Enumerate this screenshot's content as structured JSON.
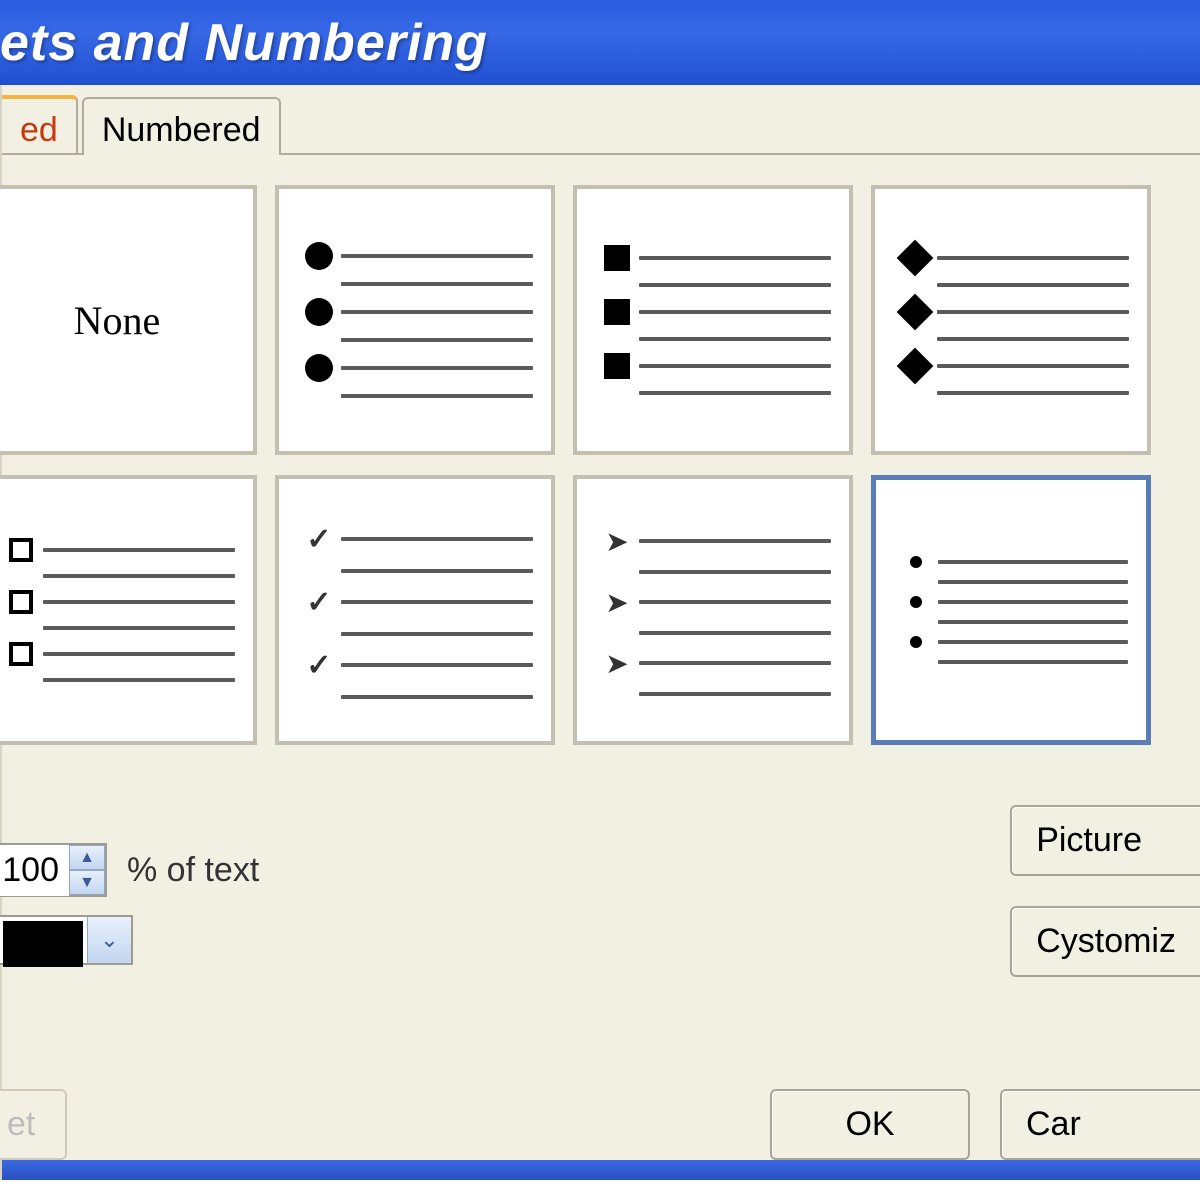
{
  "title": "ets and Numbering",
  "tabs": {
    "bulleted_partial": "ed",
    "numbered": "Numbered"
  },
  "tiles": {
    "none_label": "None",
    "selected_index": 7
  },
  "size": {
    "value": "100",
    "label": "% of text"
  },
  "buttons": {
    "picture": "Picture",
    "customize": "Cystomiz",
    "reset": "et",
    "ok": "OK",
    "cancel": "Car"
  },
  "icons": {
    "spin_up": "▲",
    "spin_down": "▼",
    "dropdown": "⌄"
  }
}
